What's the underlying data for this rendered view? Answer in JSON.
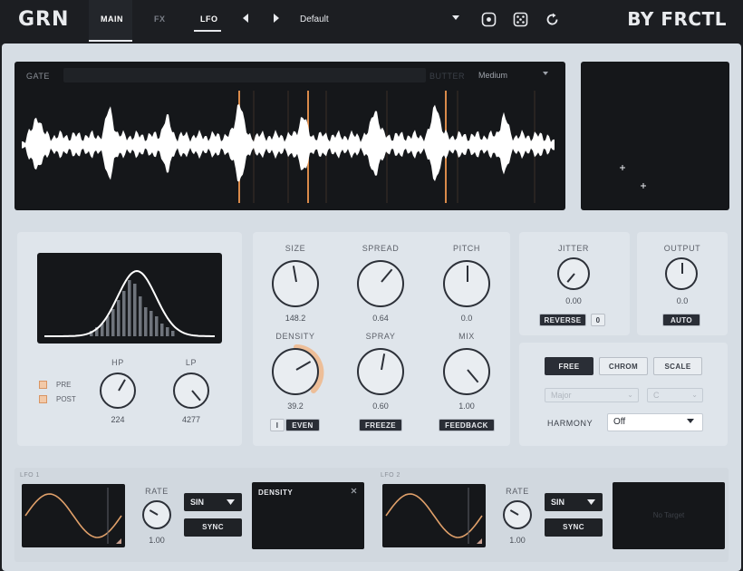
{
  "header": {
    "logo": "GRN",
    "tabs": [
      {
        "label": "MAIN",
        "active": true
      },
      {
        "label": "FX",
        "active": false
      },
      {
        "label": "LFO",
        "active": true
      }
    ],
    "prev_icon": "triangle-left-icon",
    "next_icon": "triangle-right-icon",
    "preset_name": "Default",
    "preset_dropdown_icon": "caret-down-icon",
    "icons": [
      "target-icon",
      "dice-icon",
      "refresh-icon"
    ],
    "brand": "BY FRCTL"
  },
  "waveform": {
    "gate_label": "GATE",
    "butter_label": "BUTTER",
    "butter_value": "Medium",
    "waveform_color": "#ffffff",
    "marker_color": "#d98a4a"
  },
  "filter": {
    "pre_label": "PRE",
    "post_label": "POST",
    "hp": {
      "label": "HP",
      "value": "224"
    },
    "lp": {
      "label": "LP",
      "value": "4277"
    }
  },
  "grain": {
    "size": {
      "label": "SIZE",
      "value": "148.2"
    },
    "spread": {
      "label": "SPREAD",
      "value": "0.64"
    },
    "pitch": {
      "label": "PITCH",
      "value": "0.0"
    },
    "density": {
      "label": "DENSITY",
      "value": "39.2",
      "mod_color": "#f0b78a"
    },
    "spray": {
      "label": "SPRAY",
      "value": "0.60"
    },
    "mix": {
      "label": "MIX",
      "value": "1.00"
    },
    "even_toggle_label": "I",
    "even_label": "EVEN",
    "freeze_label": "FREEZE",
    "feedback_label": "FEEDBACK"
  },
  "jitter": {
    "label": "JITTER",
    "value": "0.00",
    "reverse_label": "REVERSE",
    "reverse_value": "0"
  },
  "output": {
    "label": "OUTPUT",
    "value": "0.0",
    "auto_label": "AUTO"
  },
  "harmony": {
    "modes": [
      {
        "label": "FREE",
        "active": true
      },
      {
        "label": "CHROM",
        "active": false
      },
      {
        "label": "SCALE",
        "active": false
      }
    ],
    "scale_value": "Major",
    "key_value": "C",
    "label": "HARMONY",
    "value": "Off"
  },
  "lfo1": {
    "label": "LFO 1",
    "rate_label": "RATE",
    "rate_value": "1.00",
    "shape": "SIN",
    "sync_label": "SYNC",
    "target": "DENSITY",
    "close_icon": "close-icon",
    "wave_color": "#e0a06a"
  },
  "lfo2": {
    "label": "LFO 2",
    "rate_label": "RATE",
    "rate_value": "1.00",
    "shape": "SIN",
    "sync_label": "SYNC",
    "target_empty": "No Target",
    "wave_color": "#e0a06a"
  }
}
